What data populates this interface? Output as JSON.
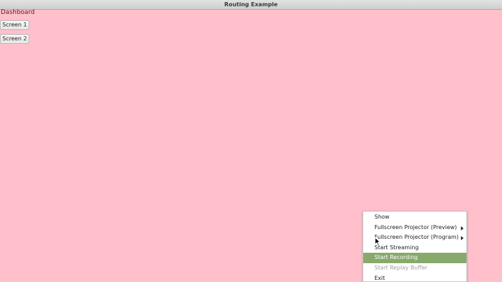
{
  "window": {
    "title": "Routing Example"
  },
  "page": {
    "heading": "Dashboard",
    "buttons": [
      {
        "label": "Screen 1"
      },
      {
        "label": "Screen 2"
      }
    ]
  },
  "context_menu": {
    "items": [
      {
        "label": "Show",
        "state": "normal",
        "has_submenu": false
      },
      {
        "label": "Fullscreen Projector (Preview)",
        "state": "normal",
        "has_submenu": true
      },
      {
        "label": "Fullscreen Projector (Program)",
        "state": "normal",
        "has_submenu": true
      },
      {
        "label": "Start Streaming",
        "state": "normal",
        "has_submenu": false
      },
      {
        "label": "Start Recording",
        "state": "highlighted",
        "has_submenu": false
      },
      {
        "label": "Start Replay Buffer",
        "state": "disabled",
        "has_submenu": false
      },
      {
        "label": "Exit",
        "state": "normal",
        "has_submenu": false
      }
    ]
  },
  "colors": {
    "background": "#ffc0cb",
    "menu_highlight": "#87a96b",
    "disabled_text": "#a0a0a0"
  },
  "icons": [
    "submenu-arrow-icon",
    "mouse-pointer-icon"
  ]
}
